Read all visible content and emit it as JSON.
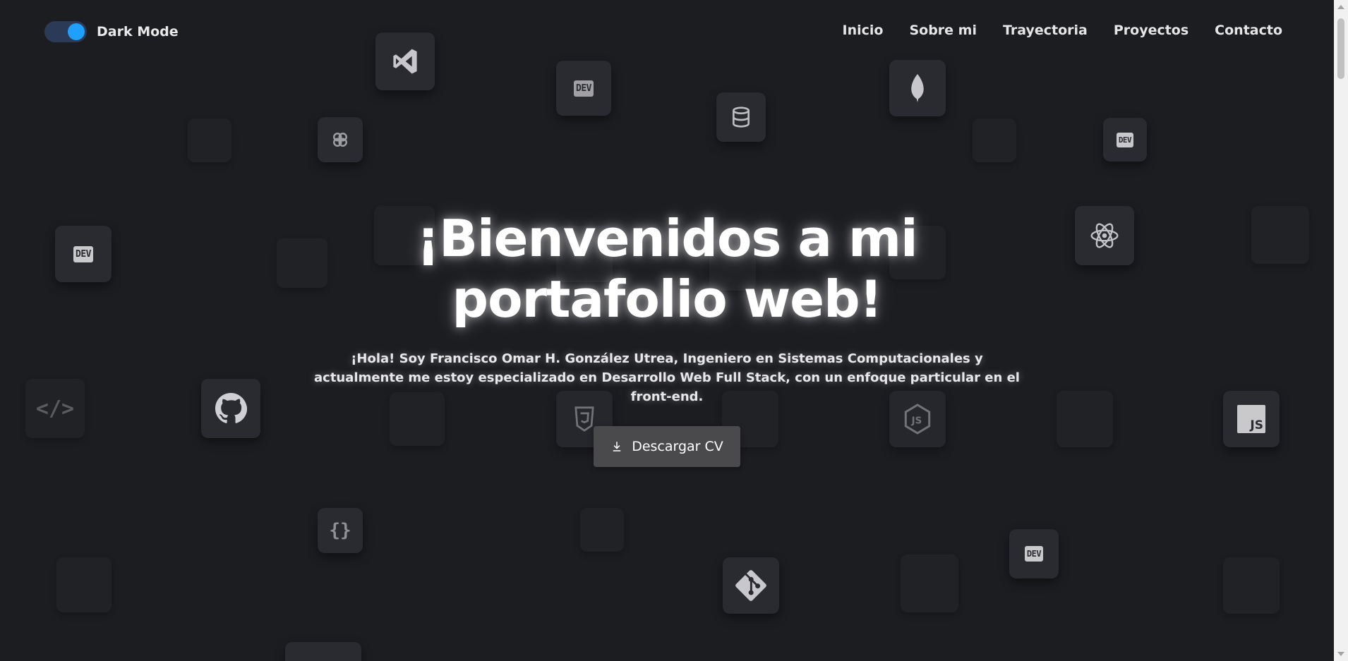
{
  "header": {
    "toggle_label": "Dark Mode",
    "toggle_on": true,
    "nav": [
      {
        "label": "Inicio"
      },
      {
        "label": "Sobre mi"
      },
      {
        "label": "Trayectoria"
      },
      {
        "label": "Proyectos"
      },
      {
        "label": "Contacto"
      }
    ]
  },
  "hero": {
    "title": "¡Bienvenidos a mi portafolio web!",
    "intro": "¡Hola! Soy Francisco Omar H. González Utrea, Ingeniero en Sistemas Computacionales y actualmente me estoy especializado en Desarrollo Web Full Stack, con un enfoque particular en el front-end.",
    "cv_button": "Descargar CV"
  },
  "background_icons": {
    "dev_badge_text": "DEV",
    "js_badge_text": "JS",
    "code_tag_text": "</>",
    "braces_text": "{}"
  },
  "colors": {
    "background": "#1c1d21",
    "tile": "#2a2b30",
    "toggle_knob": "#1fa0ff",
    "toggle_track": "#2b3a57",
    "button": "#4a4a4c"
  }
}
